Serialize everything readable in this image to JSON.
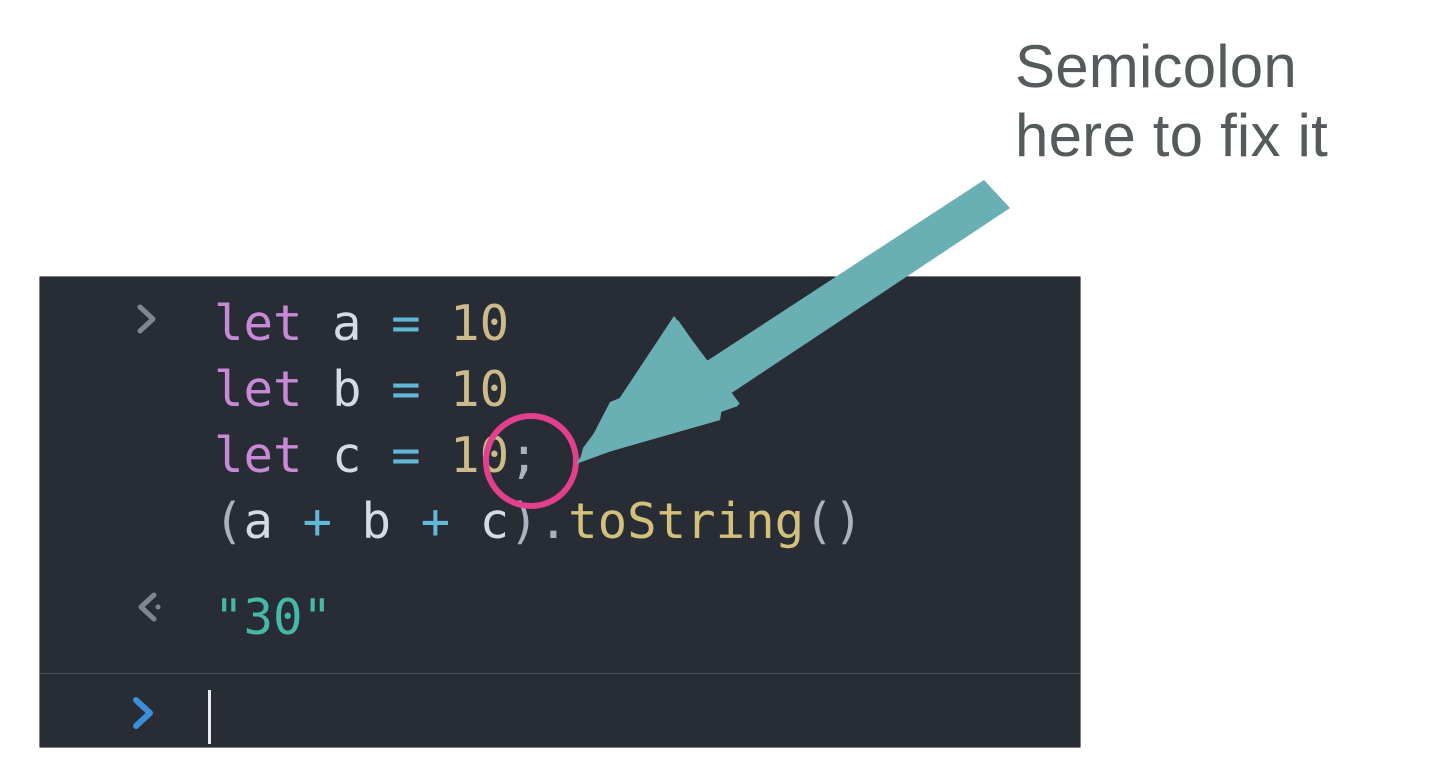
{
  "annotation": {
    "line1": "Semicolon",
    "line2": "here to fix it"
  },
  "console": {
    "input_lines": [
      {
        "keyword": "let",
        "name": "a",
        "op": "=",
        "value": "10",
        "suffix": ""
      },
      {
        "keyword": "let",
        "name": "b",
        "op": "=",
        "value": "10",
        "suffix": ""
      },
      {
        "keyword": "let",
        "name": "c",
        "op": "=",
        "value": "10",
        "suffix": ";"
      }
    ],
    "expr": {
      "open": "(",
      "a": "a",
      "plus1": " + ",
      "b": "b",
      "plus2": " + ",
      "c": "c",
      "close": ")",
      "dot": ".",
      "method": "toString",
      "call_open": "(",
      "call_close": ")"
    },
    "output_value": "\"30\""
  },
  "colors": {
    "arrow": "#6aafb4",
    "circle": "#e23f8c",
    "prompt_chevron": "#3a8fd8"
  }
}
